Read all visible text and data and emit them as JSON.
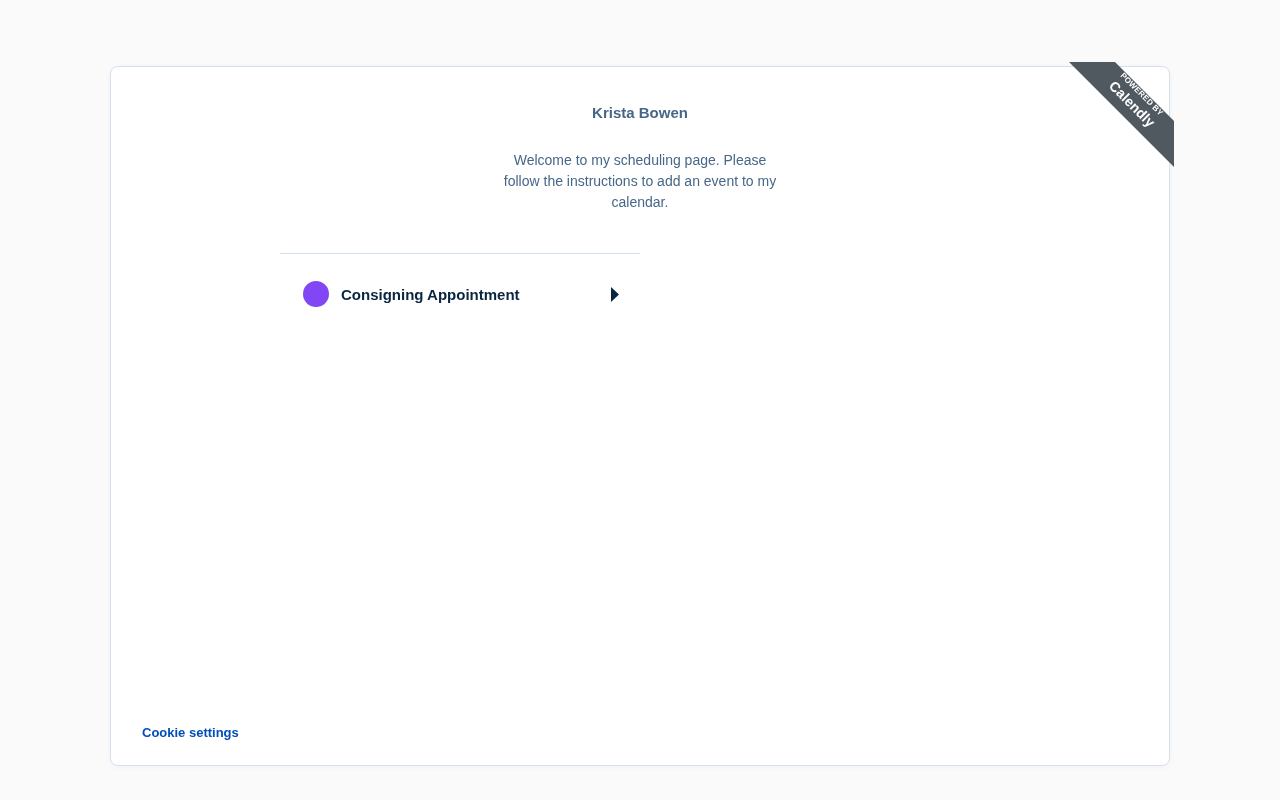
{
  "profile": {
    "name": "Krista Bowen",
    "welcome": "Welcome to my scheduling page. Please follow the instructions to add an event to my calendar."
  },
  "event_types": [
    {
      "name": "Consigning Appointment",
      "color": "#8247f5"
    }
  ],
  "ribbon": {
    "line_1": "POWERED BY",
    "line_2": "Calendly"
  },
  "footer": {
    "link": "Cookie settings"
  }
}
